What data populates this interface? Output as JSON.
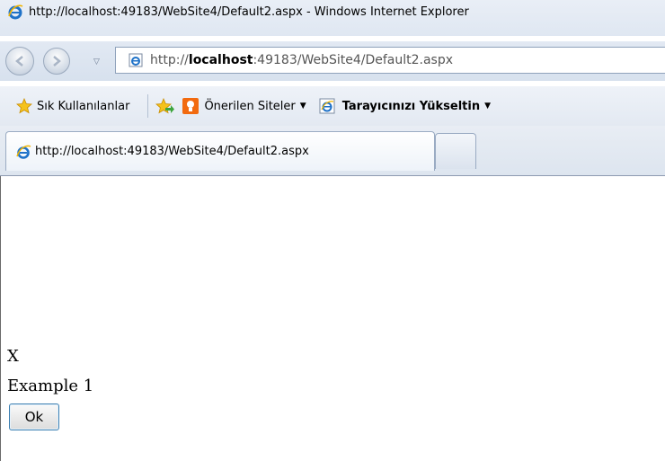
{
  "window": {
    "title": "http://localhost:49183/WebSite4/Default2.aspx - Windows Internet Explorer"
  },
  "address_bar": {
    "url_prefix": "http://",
    "url_host": "localhost",
    "url_rest": ":49183/WebSite4/Default2.aspx"
  },
  "favorites_bar": {
    "favorites_label": "Sık Kullanılanlar",
    "suggested_sites_label": "Önerilen Siteler",
    "upgrade_label": "Tarayıcınızı Yükseltin"
  },
  "tabs": [
    {
      "label": "http://localhost:49183/WebSite4/Default2.aspx"
    }
  ],
  "page": {
    "line1": "X",
    "line2": "Example 1",
    "ok_button": "Ok"
  }
}
